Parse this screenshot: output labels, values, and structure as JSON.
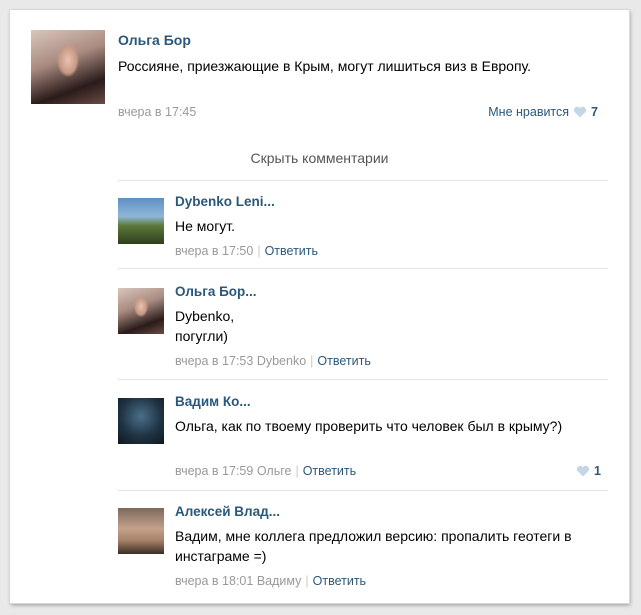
{
  "post": {
    "author": "Ольга Бор",
    "text": "Россияне, приезжающие в Крым, могут лишиться виз в Европу.",
    "date": "вчера в 17:45",
    "like_label": "Мне нравится",
    "like_count": "7"
  },
  "hide_comments_label": "Скрыть комментарии",
  "comments": [
    {
      "author": "Dybenko Leni...",
      "text": "Не могут.",
      "date": "вчера в 17:50",
      "reply_to": "",
      "reply_label": "Ответить"
    },
    {
      "author": "Ольга Бор...",
      "text": "Dybenko, погугли)",
      "date": "вчера в 17:53",
      "reply_to": "Dybenko",
      "reply_label": "Ответить"
    },
    {
      "author": "Вадим Ко...",
      "text": "Ольга, как по твоему проверить что человек был в крыму?)",
      "date": "вчера в 17:59",
      "reply_to": "Ольге",
      "reply_label": "Ответить",
      "like_count": "1"
    },
    {
      "author": "Алексей Влад...",
      "text": "Вадим, мне коллега предложил версию: пропалить геотеги в инстаграме =)",
      "date": "вчера в 18:01",
      "reply_to": "Вадиму",
      "reply_label": "Ответить"
    }
  ],
  "colors": {
    "link": "#2b587a",
    "meta": "#999999",
    "heart": "#c5d6e6"
  }
}
